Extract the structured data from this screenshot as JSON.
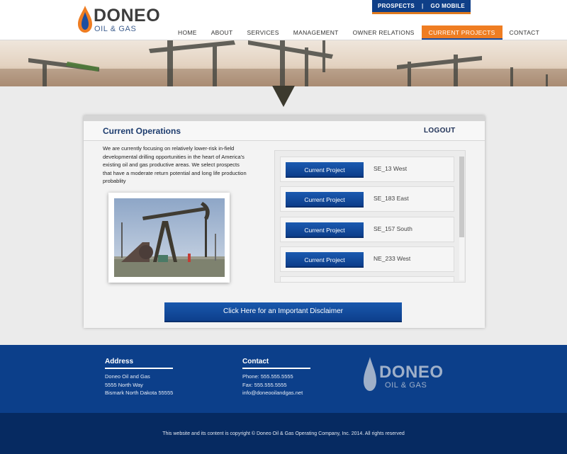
{
  "brand": {
    "name": "DONEO",
    "tagline": "OIL & GAS"
  },
  "top_links": {
    "prospects": "PROSPECTS",
    "separator": "|",
    "go_mobile": "GO MOBILE"
  },
  "nav": {
    "items": [
      "HOME",
      "ABOUT",
      "SERVICES",
      "MANAGEMENT",
      "OWNER RELATIONS",
      "CURRENT PROJECTS",
      "CONTACT"
    ],
    "active": "CURRENT PROJECTS"
  },
  "panel": {
    "title": "Current Operations",
    "logout": "LOGOUT",
    "intro": "We are currently focusing on relatively lower-risk in-field developmental drilling opportunities in the heart of America's existing oil and gas productive areas. We select prospects that have a moderate return potential and long life production probablity"
  },
  "projects": [
    {
      "button": "Current Project",
      "code": "SE_13 West"
    },
    {
      "button": "Current Project",
      "code": "SE_183 East"
    },
    {
      "button": "Current Project",
      "code": "SE_157 South"
    },
    {
      "button": "Current Project",
      "code": "NE_233 West"
    },
    {
      "button": "",
      "code": ""
    }
  ],
  "disclaimer_button": "Click Here for an Important Disclaimer",
  "footer": {
    "address": {
      "heading": "Address",
      "lines": [
        "Doneo Oil and Gas",
        "5555 North Way",
        "Bismark North Dakota 55555"
      ]
    },
    "contact": {
      "heading": "Contact",
      "lines": [
        "Phone: 555.555.5555",
        "Fax: 555.555.5555",
        "info@doneooilandgas.net"
      ]
    },
    "logo_name": "DONEO",
    "logo_tagline": "OIL & GAS",
    "copyright": "This website and its content is copyright © Doneo Oil & Gas Operating Company, Inc. 2014. All rights reserved"
  },
  "colors": {
    "primary_blue": "#0c3f8a",
    "accent_orange": "#ef7d22",
    "footer_dark": "#062a61"
  },
  "icons": [
    "flame-drop-icon"
  ]
}
